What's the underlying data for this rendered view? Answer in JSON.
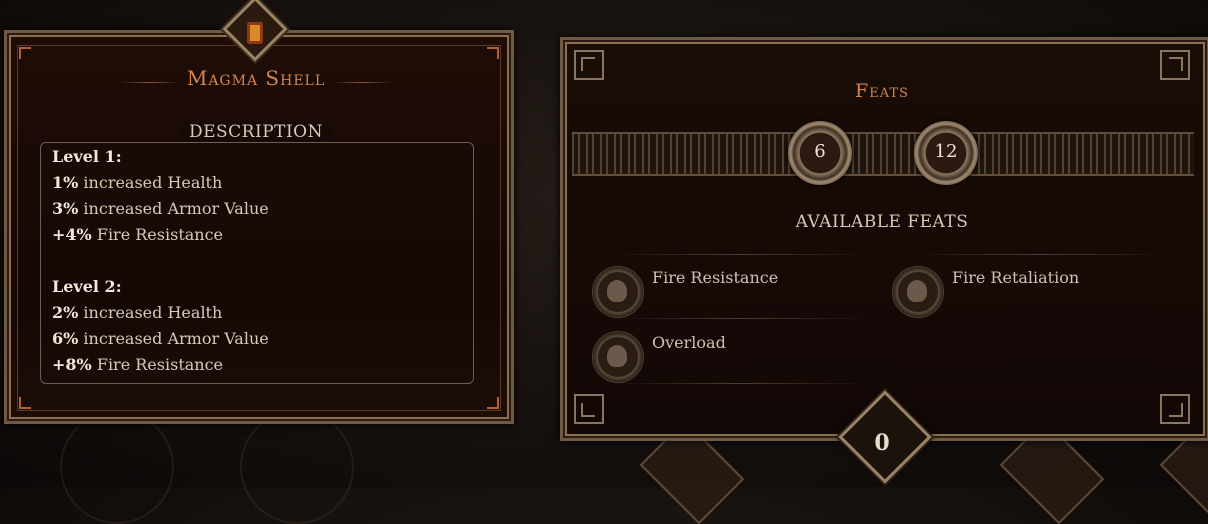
{
  "skill_panel": {
    "title": "Magma Shell",
    "description_heading": "DESCRIPTION",
    "levels": [
      {
        "heading": "Level 1:",
        "stats": [
          {
            "value": "1%",
            "text": " increased Health"
          },
          {
            "value": "3%",
            "text": " increased Armor Value"
          },
          {
            "value": "+4%",
            "text": " Fire Resistance"
          }
        ]
      },
      {
        "heading": "Level 2:",
        "stats": [
          {
            "value": "2%",
            "text": " increased Health"
          },
          {
            "value": "6%",
            "text": " increased Armor Value"
          },
          {
            "value": "+8%",
            "text": " Fire Resistance"
          }
        ]
      }
    ]
  },
  "feats_panel": {
    "title": "Feats",
    "counter_left": "6",
    "counter_right": "12",
    "available_heading": "AVAILABLE FEATS",
    "feats": [
      {
        "label": "Fire Resistance",
        "icon": "fire-resistance-icon"
      },
      {
        "label": "Fire Retaliation",
        "icon": "fire-retaliation-icon"
      },
      {
        "label": "Overload",
        "icon": "overload-icon"
      }
    ]
  },
  "points_counter": "0",
  "colors": {
    "title_accent": "#d2864e",
    "frame": "#8a6f52",
    "text": "#d8cab6"
  }
}
